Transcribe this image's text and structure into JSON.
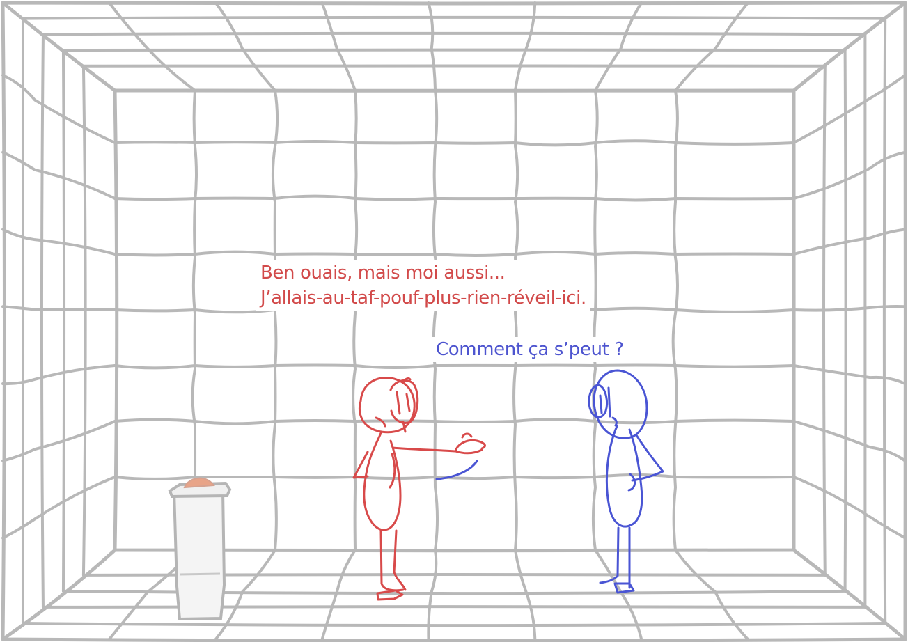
{
  "dialogue": {
    "red_line_1": "Ben ouais, mais moi aussi...",
    "red_line_2": "J’allais-au-taf-pouf-plus-rien-réveil-ici.",
    "blue_line": "Comment ça s’peut ?"
  },
  "colors": {
    "background": "#ffffff",
    "padding_grid": "#b8b8b8",
    "red_character": "#d84a4a",
    "blue_character": "#4a55d4",
    "button_top": "#e8a488",
    "caption_red": "#d24a4a",
    "caption_blue": "#4d54cf"
  },
  "icons": {
    "red_character": "stick-figure-icon",
    "blue_character": "stick-figure-icon",
    "pedestal": "button-pedestal-icon"
  }
}
